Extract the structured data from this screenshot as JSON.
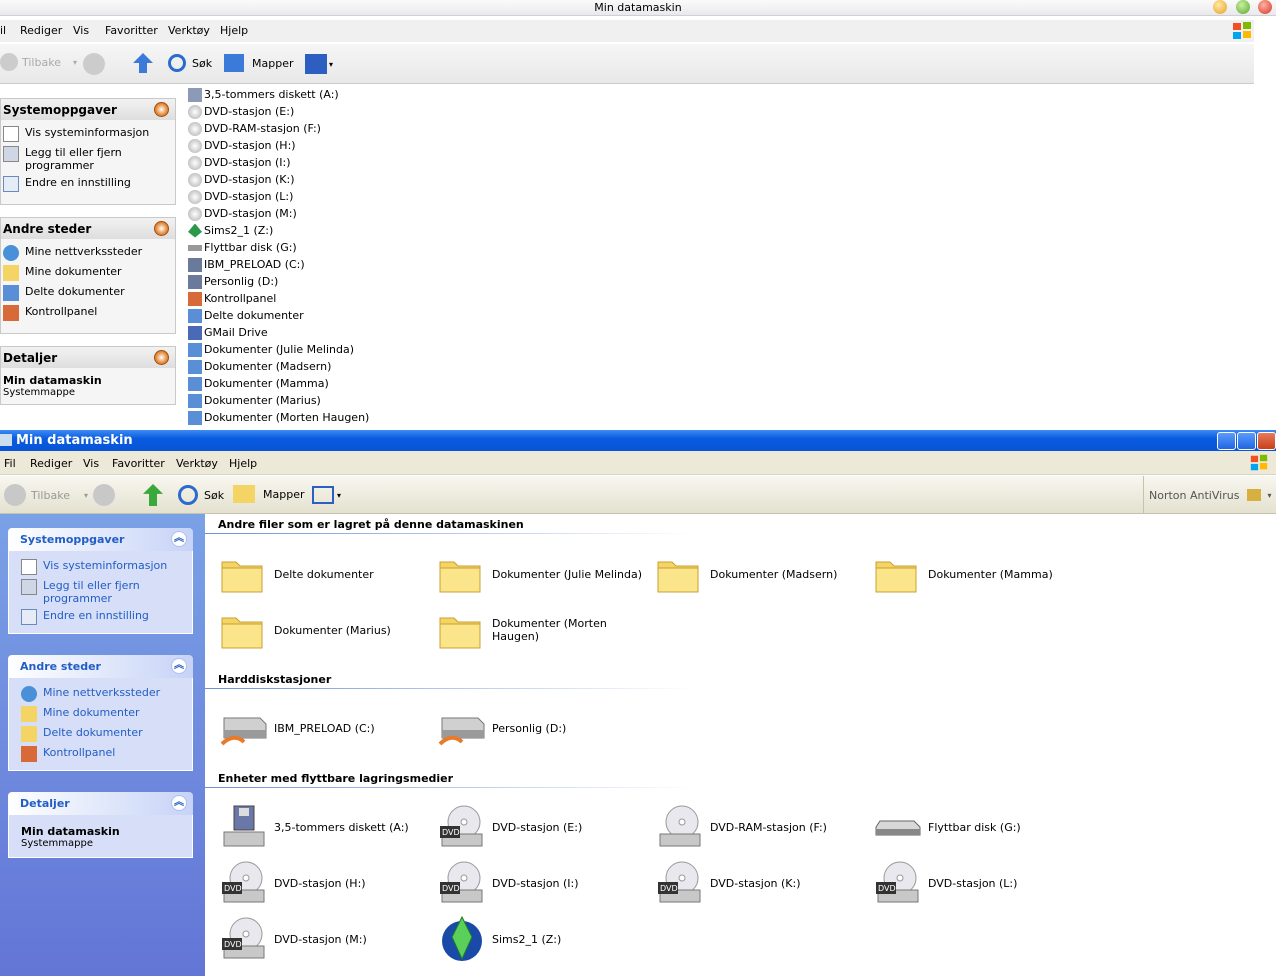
{
  "w1": {
    "title": "Min datamaskin",
    "menu": [
      "il",
      "Rediger",
      "Vis",
      "Favoritter",
      "Verktøy",
      "Hjelp"
    ],
    "toolbar": {
      "back": "Tilbake",
      "search": "Søk",
      "folders": "Mapper"
    },
    "panes": [
      {
        "title": "Systemoppgaver",
        "items": [
          "Vis systeminformasjon",
          "Legg til eller fjern programmer",
          "Endre en innstilling"
        ]
      },
      {
        "title": "Andre steder",
        "items": [
          "Mine nettverkssteder",
          "Mine dokumenter",
          "Delte dokumenter",
          "Kontrollpanel"
        ]
      },
      {
        "title": "Detaljer",
        "name": "Min datamaskin",
        "type": "Systemmappe"
      }
    ],
    "list": [
      "3,5-tommers diskett (A:)",
      "DVD-stasjon (E:)",
      "DVD-RAM-stasjon (F:)",
      "DVD-stasjon (H:)",
      "DVD-stasjon (I:)",
      "DVD-stasjon (K:)",
      "DVD-stasjon (L:)",
      "DVD-stasjon (M:)",
      "Sims2_1 (Z:)",
      "Flyttbar disk (G:)",
      "IBM_PRELOAD (C:)",
      "Personlig (D:)",
      "Kontrollpanel",
      "Delte dokumenter",
      "GMail Drive",
      "Dokumenter (Julie Melinda)",
      "Dokumenter (Madsern)",
      "Dokumenter (Mamma)",
      "Dokumenter (Marius)",
      "Dokumenter (Morten Haugen)"
    ]
  },
  "w2": {
    "title": "Min datamaskin",
    "menu": [
      "Fil",
      "Rediger",
      "Vis",
      "Favoritter",
      "Verktøy",
      "Hjelp"
    ],
    "toolbar": {
      "back": "Tilbake",
      "search": "Søk",
      "folders": "Mapper",
      "norton": "Norton AntiVirus"
    },
    "panes": [
      {
        "title": "Systemoppgaver",
        "items": [
          "Vis systeminformasjon",
          "Legg til eller fjern programmer",
          "Endre en innstilling"
        ]
      },
      {
        "title": "Andre steder",
        "items": [
          "Mine nettverkssteder",
          "Mine dokumenter",
          "Delte dokumenter",
          "Kontrollpanel"
        ]
      },
      {
        "title": "Detaljer",
        "name": "Min datamaskin",
        "type": "Systemmappe"
      }
    ],
    "groups": [
      {
        "title": "Andre filer som er lagret på denne datamaskinen",
        "items": [
          "Delte dokumenter",
          "Dokumenter (Julie Melinda)",
          "Dokumenter (Madsern)",
          "Dokumenter (Mamma)",
          "Dokumenter (Marius)",
          "Dokumenter (Morten Haugen)"
        ]
      },
      {
        "title": "Harddiskstasjoner",
        "items": [
          "IBM_PRELOAD (C:)",
          "Personlig (D:)"
        ]
      },
      {
        "title": "Enheter med flyttbare lagringsmedier",
        "items": [
          "3,5-tommers diskett (A:)",
          "DVD-stasjon (E:)",
          "DVD-RAM-stasjon (F:)",
          "Flyttbar disk (G:)",
          "DVD-stasjon (H:)",
          "DVD-stasjon (I:)",
          "DVD-stasjon (K:)",
          "DVD-stasjon (L:)",
          "DVD-stasjon (M:)",
          "Sims2_1 (Z:)"
        ]
      }
    ]
  },
  "icons": {
    "folder": "folder-icon",
    "harddisk": "harddisk-icon",
    "dvd": "dvd-icon",
    "floppy": "floppy-icon",
    "removable": "removable-disk-icon",
    "sims": "sims-icon"
  },
  "colors": {
    "luna_blue": "#0a5be0",
    "sidebar": "#6b8ee0",
    "link": "#215dc6",
    "folder": "#f5d466"
  }
}
